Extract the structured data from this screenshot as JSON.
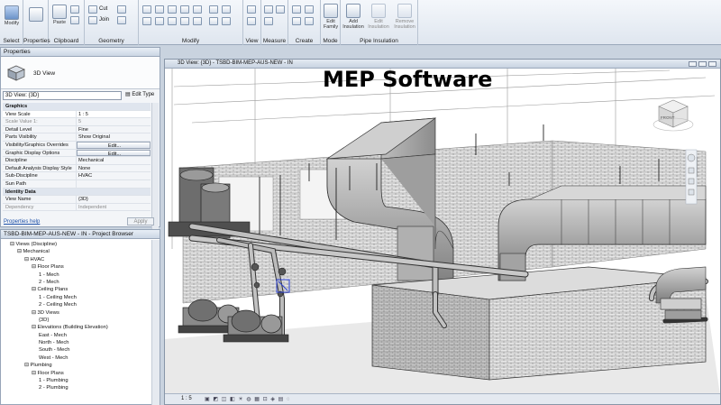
{
  "overlay": {
    "title": "MEP Software"
  },
  "ribbon": {
    "groups": [
      {
        "label": "Select"
      },
      {
        "label": "Properties"
      },
      {
        "label": "Clipboard"
      },
      {
        "label": "Geometry"
      },
      {
        "label": "Modify"
      },
      {
        "label": "View"
      },
      {
        "label": "Measure"
      },
      {
        "label": "Create"
      },
      {
        "label": "Mode"
      },
      {
        "label": "Pipe Insulation"
      }
    ],
    "buttons": {
      "modify": "Modify",
      "paste": "Paste",
      "cut": "Cut",
      "join": "Join",
      "edit_family": "Edit Family",
      "add_insulation": "Add Insulation",
      "edit_insulation": "Edit Insulation",
      "remove_insulation": "Remove Insulation"
    }
  },
  "properties": {
    "title": "Properties",
    "type_label": "3D View",
    "selector": "3D View: {3D}",
    "edit_type": "Edit Type",
    "rows": [
      {
        "k": "Graphics",
        "v": "",
        "kind": "sec"
      },
      {
        "k": "View Scale",
        "v": "1 : 5",
        "kind": "sel"
      },
      {
        "k": "Scale Value    1:",
        "v": "5",
        "kind": "grey"
      },
      {
        "k": "Detail Level",
        "v": "Fine",
        "kind": ""
      },
      {
        "k": "Parts Visibility",
        "v": "Show Original",
        "kind": ""
      },
      {
        "k": "Visibility/Graphics Overrides",
        "v": "Edit...",
        "kind": "btn"
      },
      {
        "k": "Graphic Display Options",
        "v": "Edit...",
        "kind": "btn"
      },
      {
        "k": "Discipline",
        "v": "Mechanical",
        "kind": ""
      },
      {
        "k": "Default Analysis Display Style",
        "v": "None",
        "kind": ""
      },
      {
        "k": "Sub-Discipline",
        "v": "HVAC",
        "kind": ""
      },
      {
        "k": "Sun Path",
        "v": "",
        "kind": ""
      },
      {
        "k": "Identity Data",
        "v": "",
        "kind": "sec"
      },
      {
        "k": "View Name",
        "v": "{3D}",
        "kind": ""
      },
      {
        "k": "Dependency",
        "v": "Independent",
        "kind": "grey"
      }
    ],
    "help": "Properties help",
    "apply": "Apply"
  },
  "browser": {
    "title": "TSBD-BIM-MEP-AUS-NEW - IN - Project Browser",
    "items": [
      {
        "label": "Views (Discipline)",
        "indent": 1
      },
      {
        "label": "Mechanical",
        "indent": 2
      },
      {
        "label": "HVAC",
        "indent": 3
      },
      {
        "label": "Floor Plans",
        "indent": 4
      },
      {
        "label": "1 - Mech",
        "indent": 5
      },
      {
        "label": "2 - Mech",
        "indent": 5
      },
      {
        "label": "Ceiling Plans",
        "indent": 4
      },
      {
        "label": "1 - Ceiling Mech",
        "indent": 5
      },
      {
        "label": "2 - Ceiling Mech",
        "indent": 5
      },
      {
        "label": "3D Views",
        "indent": 4
      },
      {
        "label": "{3D}",
        "indent": 5
      },
      {
        "label": "Elevations (Building Elevation)",
        "indent": 4
      },
      {
        "label": "East - Mech",
        "indent": 5
      },
      {
        "label": "North - Mech",
        "indent": 5
      },
      {
        "label": "South - Mech",
        "indent": 5
      },
      {
        "label": "West - Mech",
        "indent": 5
      },
      {
        "label": "Plumbing",
        "indent": 3
      },
      {
        "label": "Floor Plans",
        "indent": 4
      },
      {
        "label": "1 - Plumbing",
        "indent": 5
      },
      {
        "label": "2 - Plumbing",
        "indent": 5
      }
    ]
  },
  "viewport": {
    "title": "3D View: {3D} - TSBD-BIM-MEP-AUS-NEW - IN",
    "scale": "1 : 5",
    "viewcube_label": "FRONT"
  }
}
